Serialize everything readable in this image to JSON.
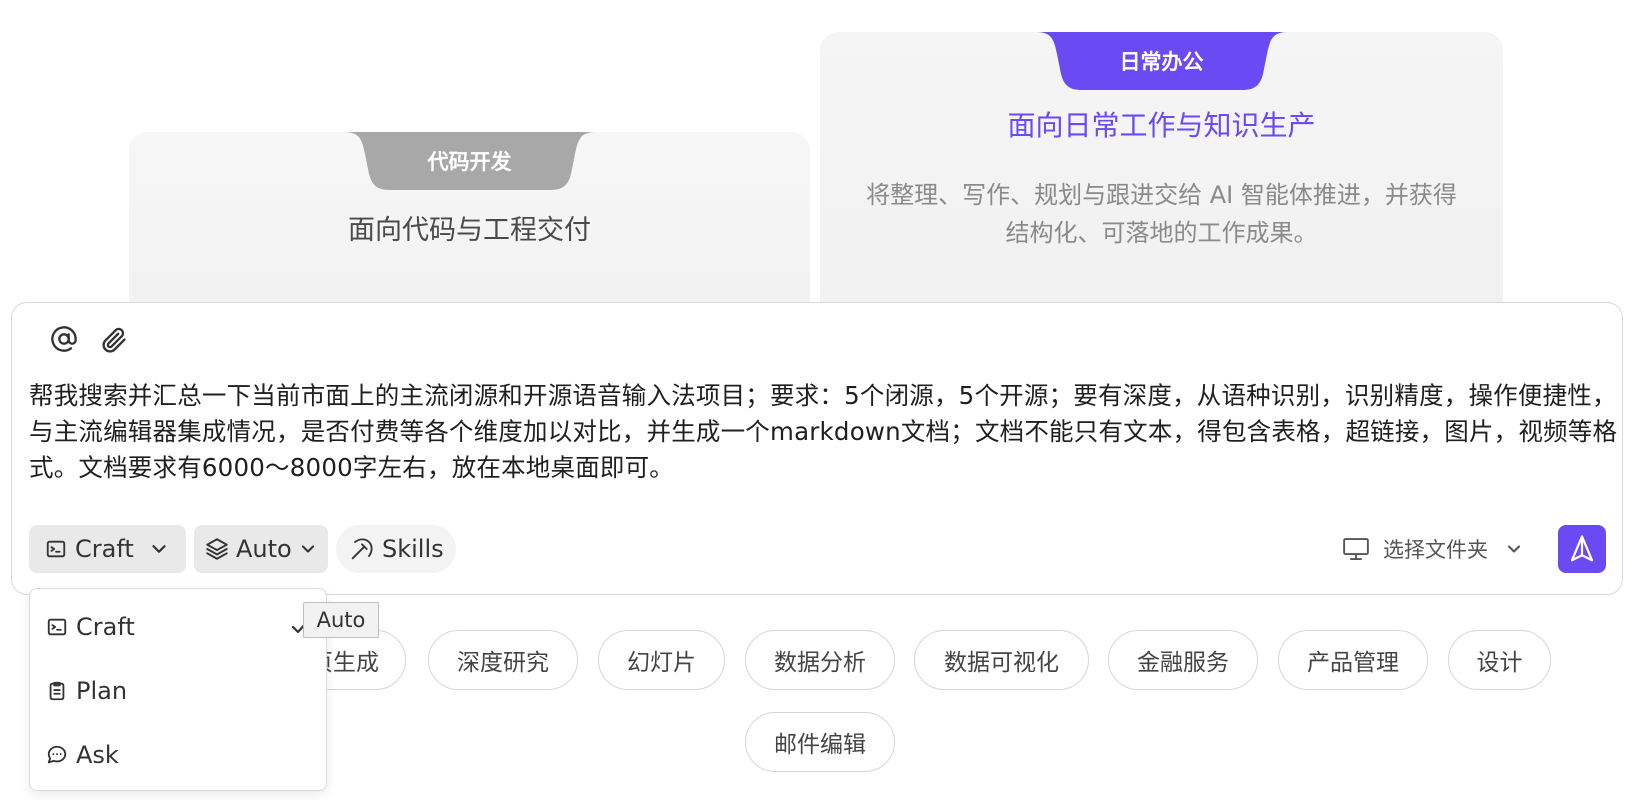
{
  "cards": {
    "code": {
      "tab_label": "代码开发",
      "title": "面向代码与工程交付",
      "tab_color": "#a8a8a8"
    },
    "office": {
      "tab_label": "日常办公",
      "title": "面向日常工作与知识生产",
      "description": "将整理、写作、规划与跟进交给 AI 智能体推进，并获得结构化、可落地的工作成果。",
      "tab_color": "#6a4af2"
    }
  },
  "composer": {
    "prompt": "帮我搜索并汇总一下当前市面上的主流闭源和开源语音输入法项目；要求：5个闭源，5个开源；要有深度，从语种识别，识别精度，操作便捷性，与主流编辑器集成情况，是否付费等各个维度加以对比，并生成一个markdown文档；文档不能只有文本，得包含表格，超链接，图片，视频等格式。文档要求有6000～8000字左右，放在本地桌面即可。",
    "mode_label": "Craft",
    "model_label": "Auto",
    "skills_label": "Skills",
    "folder_label": "选择文件夹",
    "icons": {
      "mention": "at-sign-icon",
      "attach": "paperclip-icon",
      "send": "send-arrow-icon"
    }
  },
  "mode_menu": {
    "items": [
      {
        "label": "Craft",
        "icon": "terminal-window-icon",
        "selected": true
      },
      {
        "label": "Plan",
        "icon": "clipboard-icon",
        "selected": false
      },
      {
        "label": "Ask",
        "icon": "chat-bubble-icon",
        "selected": false
      }
    ]
  },
  "tooltip": {
    "text": "Auto"
  },
  "suggestions": [
    "页生成",
    "深度研究",
    "幻灯片",
    "数据分析",
    "数据可视化",
    "金融服务",
    "产品管理",
    "设计",
    "邮件编辑"
  ],
  "colors": {
    "accent": "#6a4af2"
  }
}
